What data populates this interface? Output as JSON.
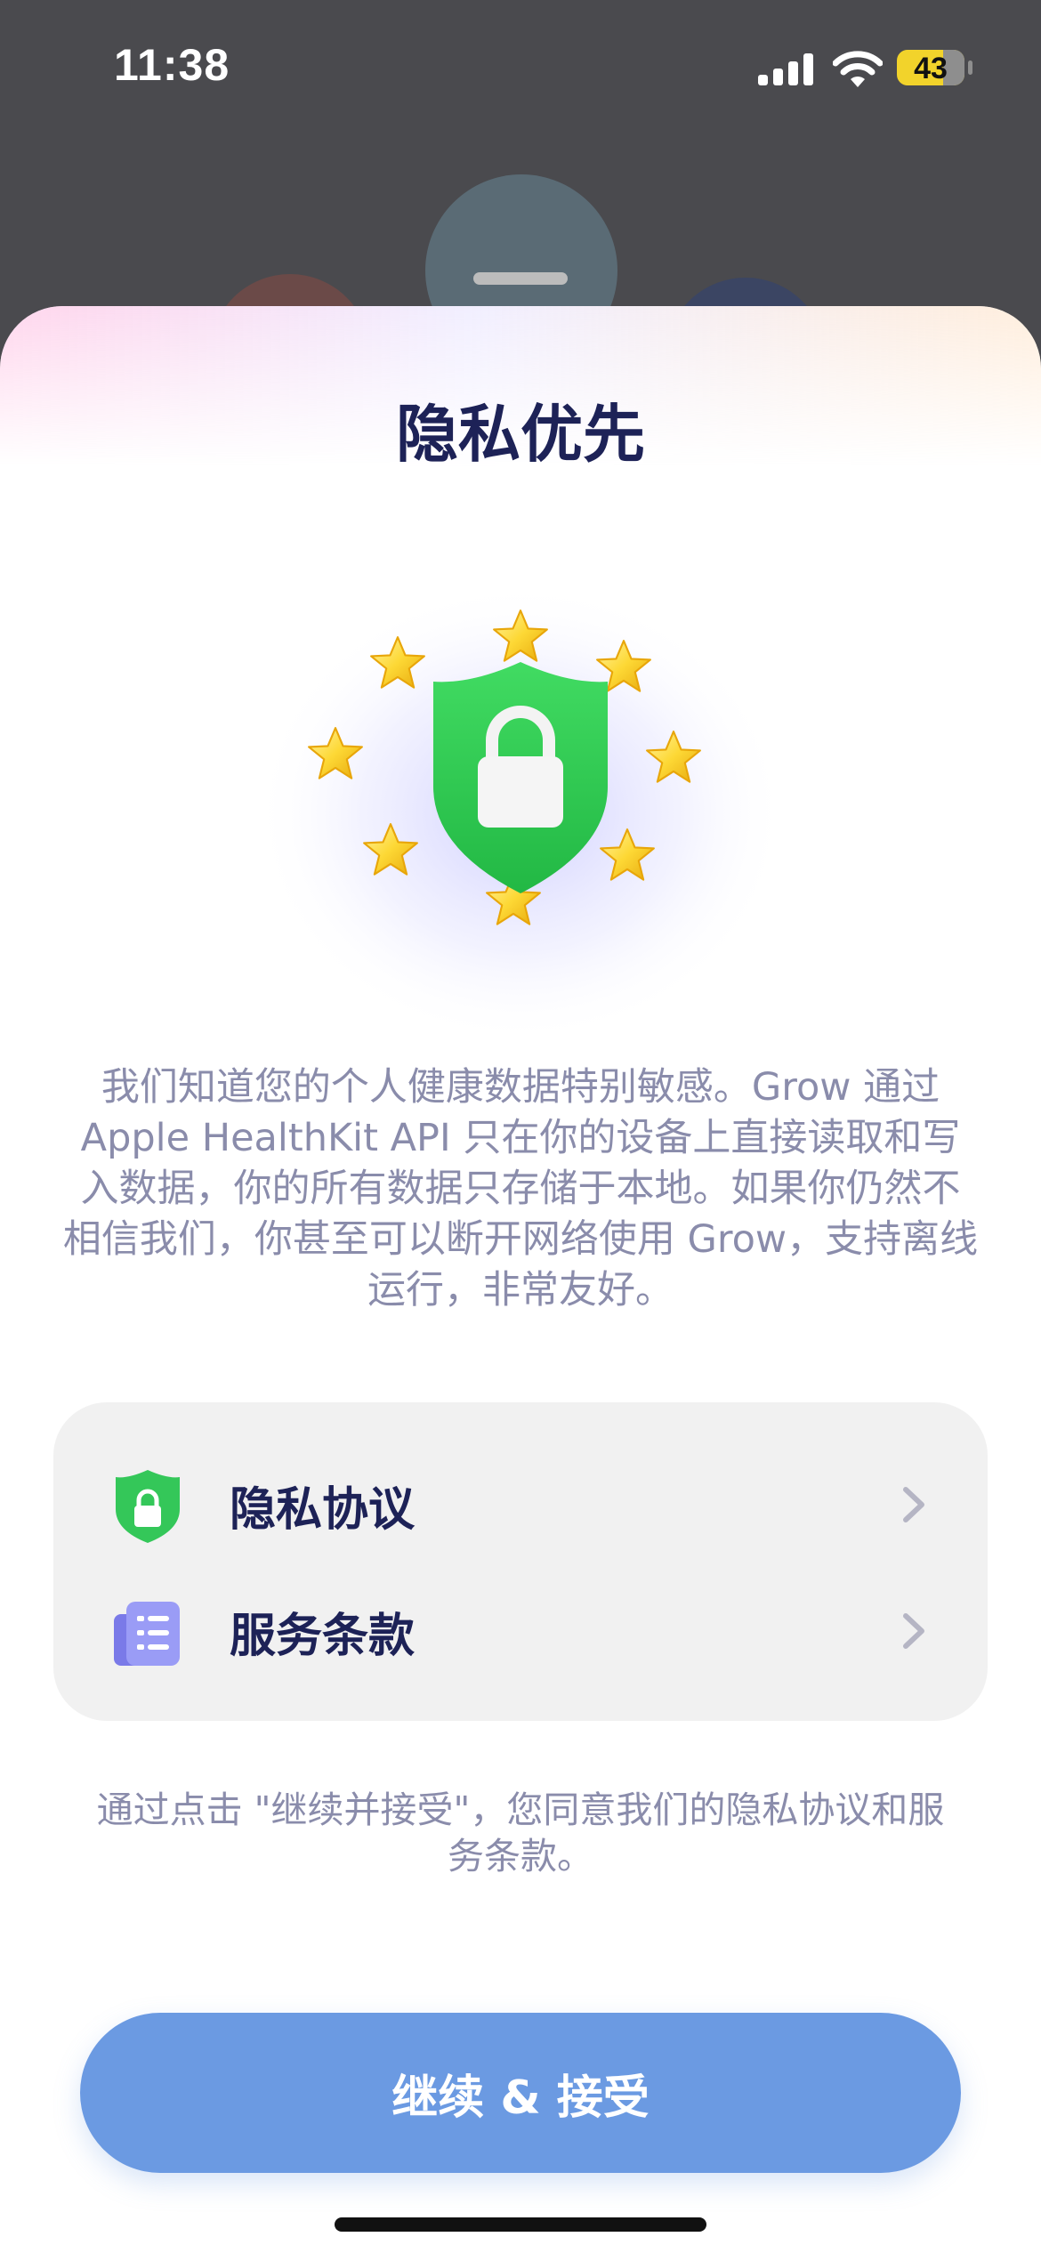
{
  "status_bar": {
    "time": "11:38",
    "battery": "43"
  },
  "sheet": {
    "title": "隐私优先",
    "description": "我们知道您的个人健康数据特别敏感。Grow 通过 Apple HealthKit API 只在你的设备上直接读取和写入数据，你的所有数据只存储于本地。如果你仍然不相信我们，你甚至可以断开网络使用 Grow，支持离线运行，非常友好。",
    "links": [
      {
        "label": "隐私协议",
        "icon": "shield-lock-icon"
      },
      {
        "label": "服务条款",
        "icon": "document-icon"
      }
    ],
    "consent_text": "通过点击 \"继续并接受\"，您同意我们的隐私协议和服务条款。",
    "continue_button": "继续 & 接受"
  },
  "colors": {
    "title": "#1d2257",
    "body_text": "#8a8cab",
    "shield_green": "#34c759",
    "button_blue": "#6b9ae2",
    "doc_purple": "#8c8cf2"
  }
}
